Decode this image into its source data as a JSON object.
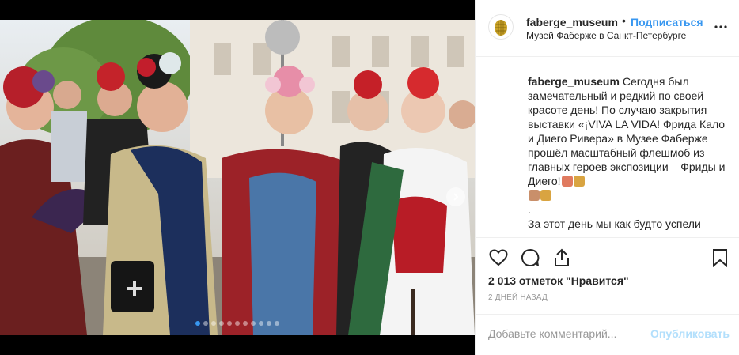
{
  "post": {
    "image_alt": "Группа женщин в образах Фриды Кало с венками из цветов",
    "carousel_dots": 11,
    "carousel_active_index": 0
  },
  "header": {
    "username": "faberge_museum",
    "separator": "•",
    "follow_label": "Подписаться",
    "location": "Музей Фаберже в Санкт-Петербурге"
  },
  "caption": {
    "username": "faberge_museum",
    "text": "Сегодня был замечательный и редкий по своей красоте день! По случаю закрытия выставки «¡VIVA LA VIDA! Фрида Кало и Диего Ривера» в Музее Фаберже прошёл масштабный флешмоб из главных героев экспозиции – Фриды и Диего!",
    "after_emoji": ".",
    "continuation": "За этот день мы как будто успели"
  },
  "stats": {
    "likes_text": "2 013 отметок \"Нравится\"",
    "time_ago": "2 ДНЕЙ НАЗАД"
  },
  "comment": {
    "placeholder": "Добавьте комментарий...",
    "publish_label": "Опубликовать"
  },
  "icons": {
    "like": "heart-icon",
    "comment": "comment-icon",
    "share": "share-icon",
    "save": "bookmark-icon",
    "more": "more-icon",
    "next": "chevron-right-icon"
  },
  "colors": {
    "accent": "#3897f0",
    "publish_disabled": "#b2dffc",
    "muted": "#999999"
  }
}
